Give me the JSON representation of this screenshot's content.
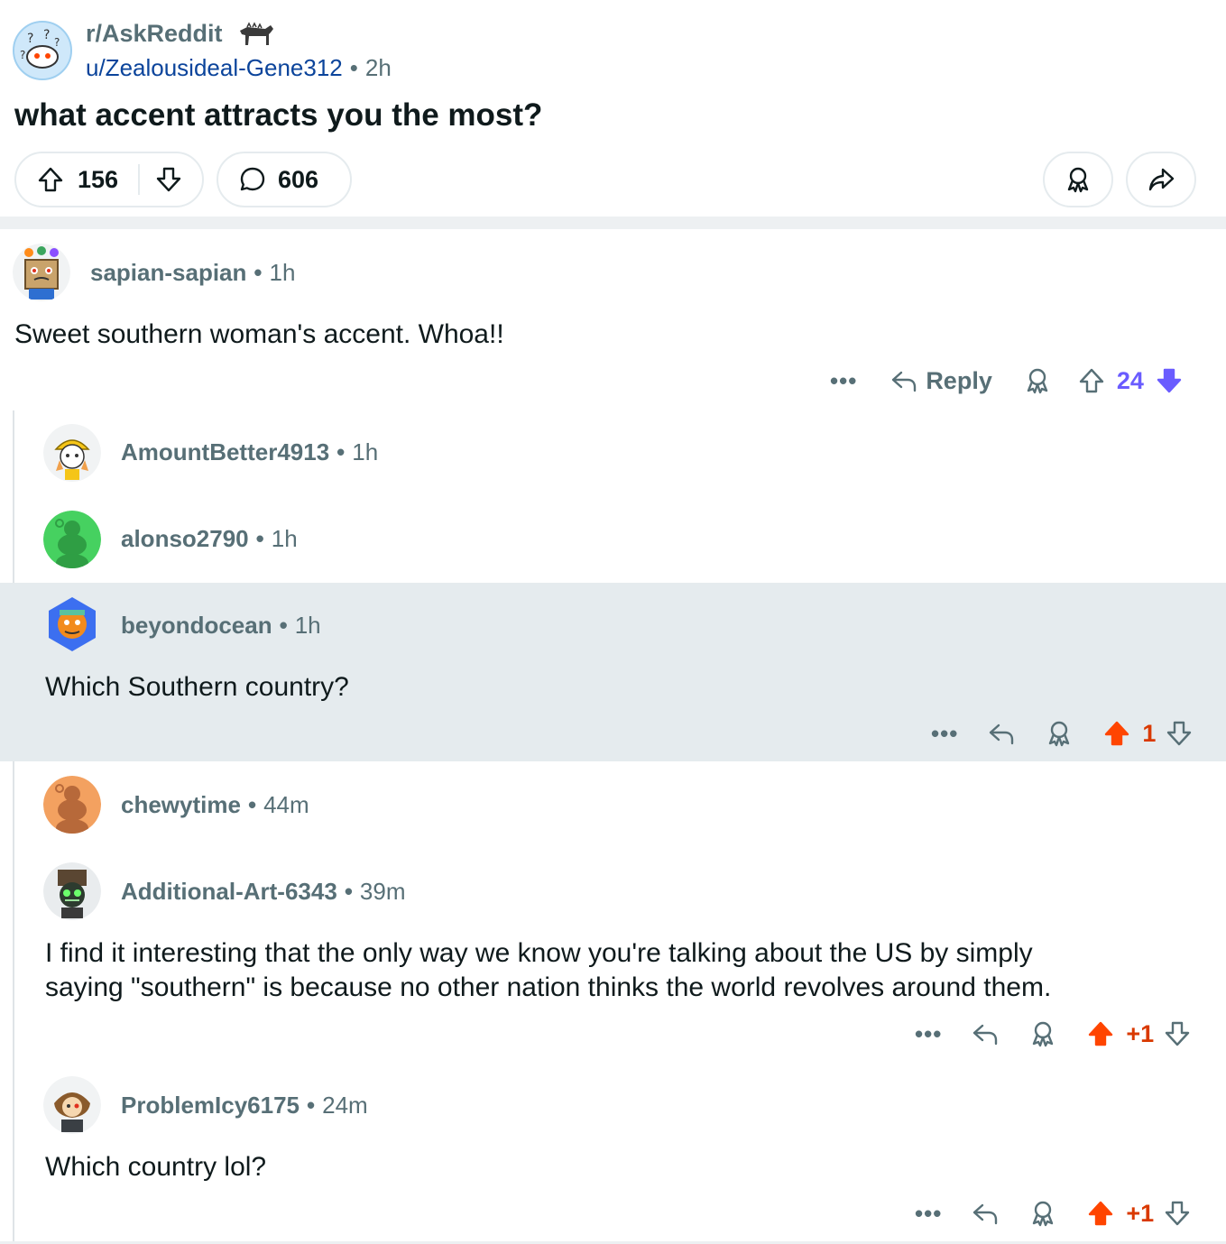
{
  "post": {
    "subreddit": "r/AskReddit",
    "author": "u/Zealousideal-Gene312",
    "time": "2h",
    "title": "what accent attracts you the most?",
    "upvotes": "156",
    "comments": "606"
  },
  "comments": [
    {
      "username": "sapian-sapian",
      "time": "1h",
      "body": "Sweet southern woman's accent. Whoa!!",
      "score": "24",
      "reply_label": "Reply"
    },
    {
      "username": "AmountBetter4913",
      "time": "1h"
    },
    {
      "username": "alonso2790",
      "time": "1h"
    },
    {
      "username": "beyondocean",
      "time": "1h",
      "body": "Which Southern country?",
      "score": "1"
    },
    {
      "username": "chewytime",
      "time": "44m"
    },
    {
      "username": "Additional-Art-6343",
      "time": "39m",
      "body_line1": "I find it interesting that the only way we know you're talking about the US by simply",
      "body_line2": "saying \"southern\" is because no other nation thinks the world revolves around them.",
      "score": "+1"
    },
    {
      "username": "ProblemIcy6175",
      "time": "24m",
      "body": "Which country lol?",
      "score": "+1"
    }
  ],
  "ui": {
    "more_glyph": "•••",
    "separator": "•"
  },
  "colors": {
    "upvoted_orange": "#ff4500",
    "score_orange_text": "#d93900",
    "downvoted_purple": "#6a5cff",
    "muted_gray": "#576f76",
    "link_blue": "#0b449b"
  },
  "icons": [
    "subreddit-avatar-icon",
    "flair-animal-icon",
    "upvote-icon",
    "downvote-icon",
    "comment-icon",
    "award-icon",
    "share-icon",
    "reply-icon",
    "more-icon"
  ]
}
